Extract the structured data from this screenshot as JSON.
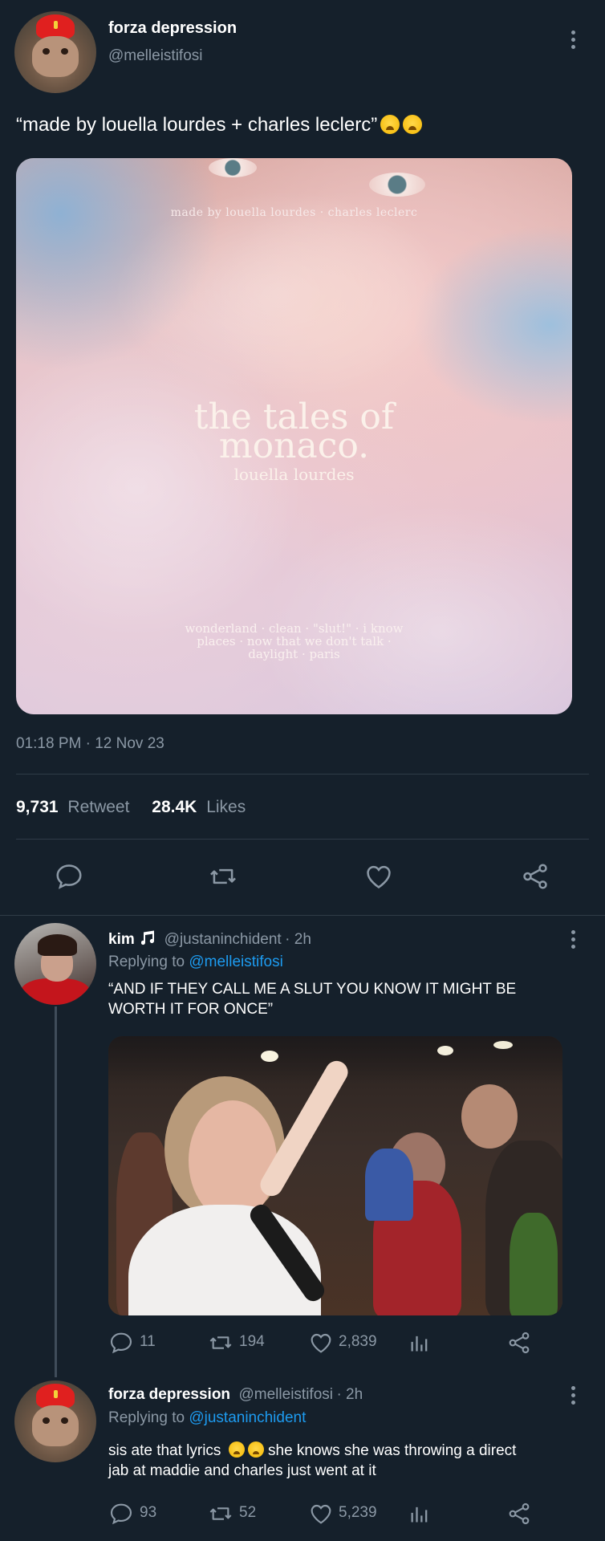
{
  "main_tweet": {
    "author_name": "forza depression",
    "author_handle": "@melleistifosi",
    "text": "“made by louella lourdes + charles leclerc”",
    "emojis": [
      "weary-face-emoji",
      "weary-face-emoji"
    ],
    "album": {
      "top_text": "made by louella lourdes · charles leclerc",
      "title_line1": "the tales of",
      "title_line2": "monaco.",
      "artist": "louella lourdes",
      "tracks_line1": "wonderland · clean · \"slut!\" · i know",
      "tracks_line2": "places · now that we don't talk ·",
      "tracks_line3": "daylight · paris"
    },
    "timestamp": "01:18 PM · 12 Nov 23",
    "retweets_count": "9,731",
    "retweets_label": "Retweet",
    "likes_count": "28.4K",
    "likes_label": "Likes",
    "action_icons": [
      "reply-icon",
      "retweet-icon",
      "like-icon",
      "share-icon"
    ]
  },
  "replies": [
    {
      "author_name": "kim",
      "author_badge": "music-note-icon",
      "author_handle": "@justaninchident",
      "time": "· 2h",
      "replying_prefix": "Replying to",
      "replying_to": "@melleistifosi",
      "text": "“AND IF THEY CALL ME A SLUT YOU KNOW IT MIGHT BE WORTH IT FOR ONCE”",
      "reply_count": "11",
      "retweet_count": "194",
      "like_count": "2,839"
    },
    {
      "author_name": "forza depression",
      "author_handle": "@melleistifosi",
      "time": "· 2h",
      "replying_prefix": "Replying to",
      "replying_to": "@justaninchident",
      "text_before_emoji": "sis ate that lyrics",
      "emojis": [
        "loudly-crying-face-emoji",
        "loudly-crying-face-emoji"
      ],
      "text_after_emoji": " she knows she was throwing a direct",
      "text_line2": "jab at maddie and charles just went at it",
      "reply_count": "93",
      "retweet_count": "52",
      "like_count": "5,239"
    }
  ],
  "colors": {
    "background": "#15202b",
    "muted": "#8b98a5",
    "link": "#1d9bf0",
    "divider": "#2f3b47"
  }
}
